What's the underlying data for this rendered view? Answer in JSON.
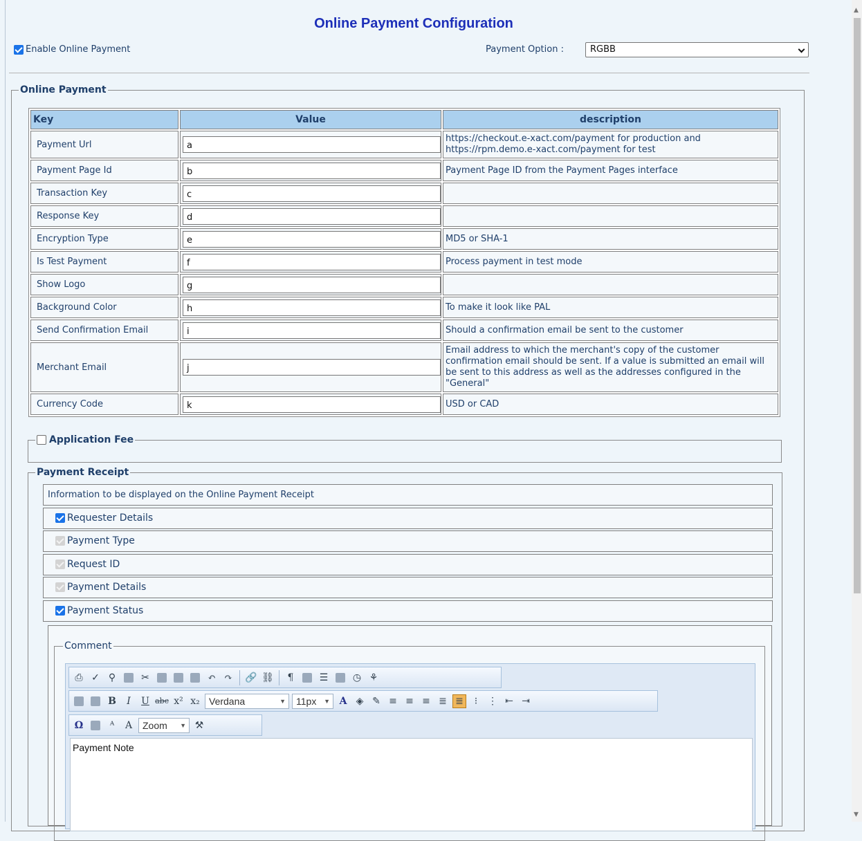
{
  "page": {
    "title": "Online Payment Configuration",
    "enable_label": "Enable Online Payment",
    "payment_option_label": "Payment Option :",
    "payment_option_value": "RGBB"
  },
  "online_payment": {
    "legend": "Online Payment",
    "columns": [
      "Key",
      "Value",
      "description"
    ],
    "rows": [
      {
        "key": "Payment Url",
        "value": "a",
        "description": "https://checkout.e-xact.com/payment for production and https://rpm.demo.e-xact.com/payment for test"
      },
      {
        "key": "Payment Page Id",
        "value": "b",
        "description": "Payment Page ID from the Payment Pages interface"
      },
      {
        "key": "Transaction Key",
        "value": "c",
        "description": ""
      },
      {
        "key": "Response Key",
        "value": "d",
        "description": ""
      },
      {
        "key": "Encryption Type",
        "value": "e",
        "description": "MD5 or SHA-1"
      },
      {
        "key": "Is Test Payment",
        "value": "f",
        "description": "Process payment in test mode"
      },
      {
        "key": "Show Logo",
        "value": "g",
        "description": ""
      },
      {
        "key": "Background Color",
        "value": "h",
        "description": "To make it look like PAL"
      },
      {
        "key": "Send Confirmation Email",
        "value": "i",
        "description": "Should a confirmation email be sent to the customer"
      },
      {
        "key": "Merchant Email",
        "value": "j",
        "description": "Email address to which the merchant's copy of the customer confirmation email should be sent. If a value is submitted an email will be sent to this address as well as the addresses configured in the \"General\""
      },
      {
        "key": "Currency Code",
        "value": "k",
        "description": "USD or CAD"
      }
    ]
  },
  "application_fee": {
    "legend": "Application Fee"
  },
  "payment_receipt": {
    "legend": "Payment Receipt",
    "info": "Information to be displayed on the Online Payment Receipt",
    "items": [
      {
        "label": "Requester Details",
        "state": "checked"
      },
      {
        "label": "Payment Type",
        "state": "disabled"
      },
      {
        "label": "Request ID",
        "state": "disabled"
      },
      {
        "label": "Payment Details",
        "state": "disabled"
      },
      {
        "label": "Payment Status",
        "state": "checked"
      }
    ],
    "comment_legend": "Comment"
  },
  "editor": {
    "font_name": "Verdana",
    "font_size": "11px",
    "zoom": "Zoom",
    "content": "Payment Note"
  }
}
